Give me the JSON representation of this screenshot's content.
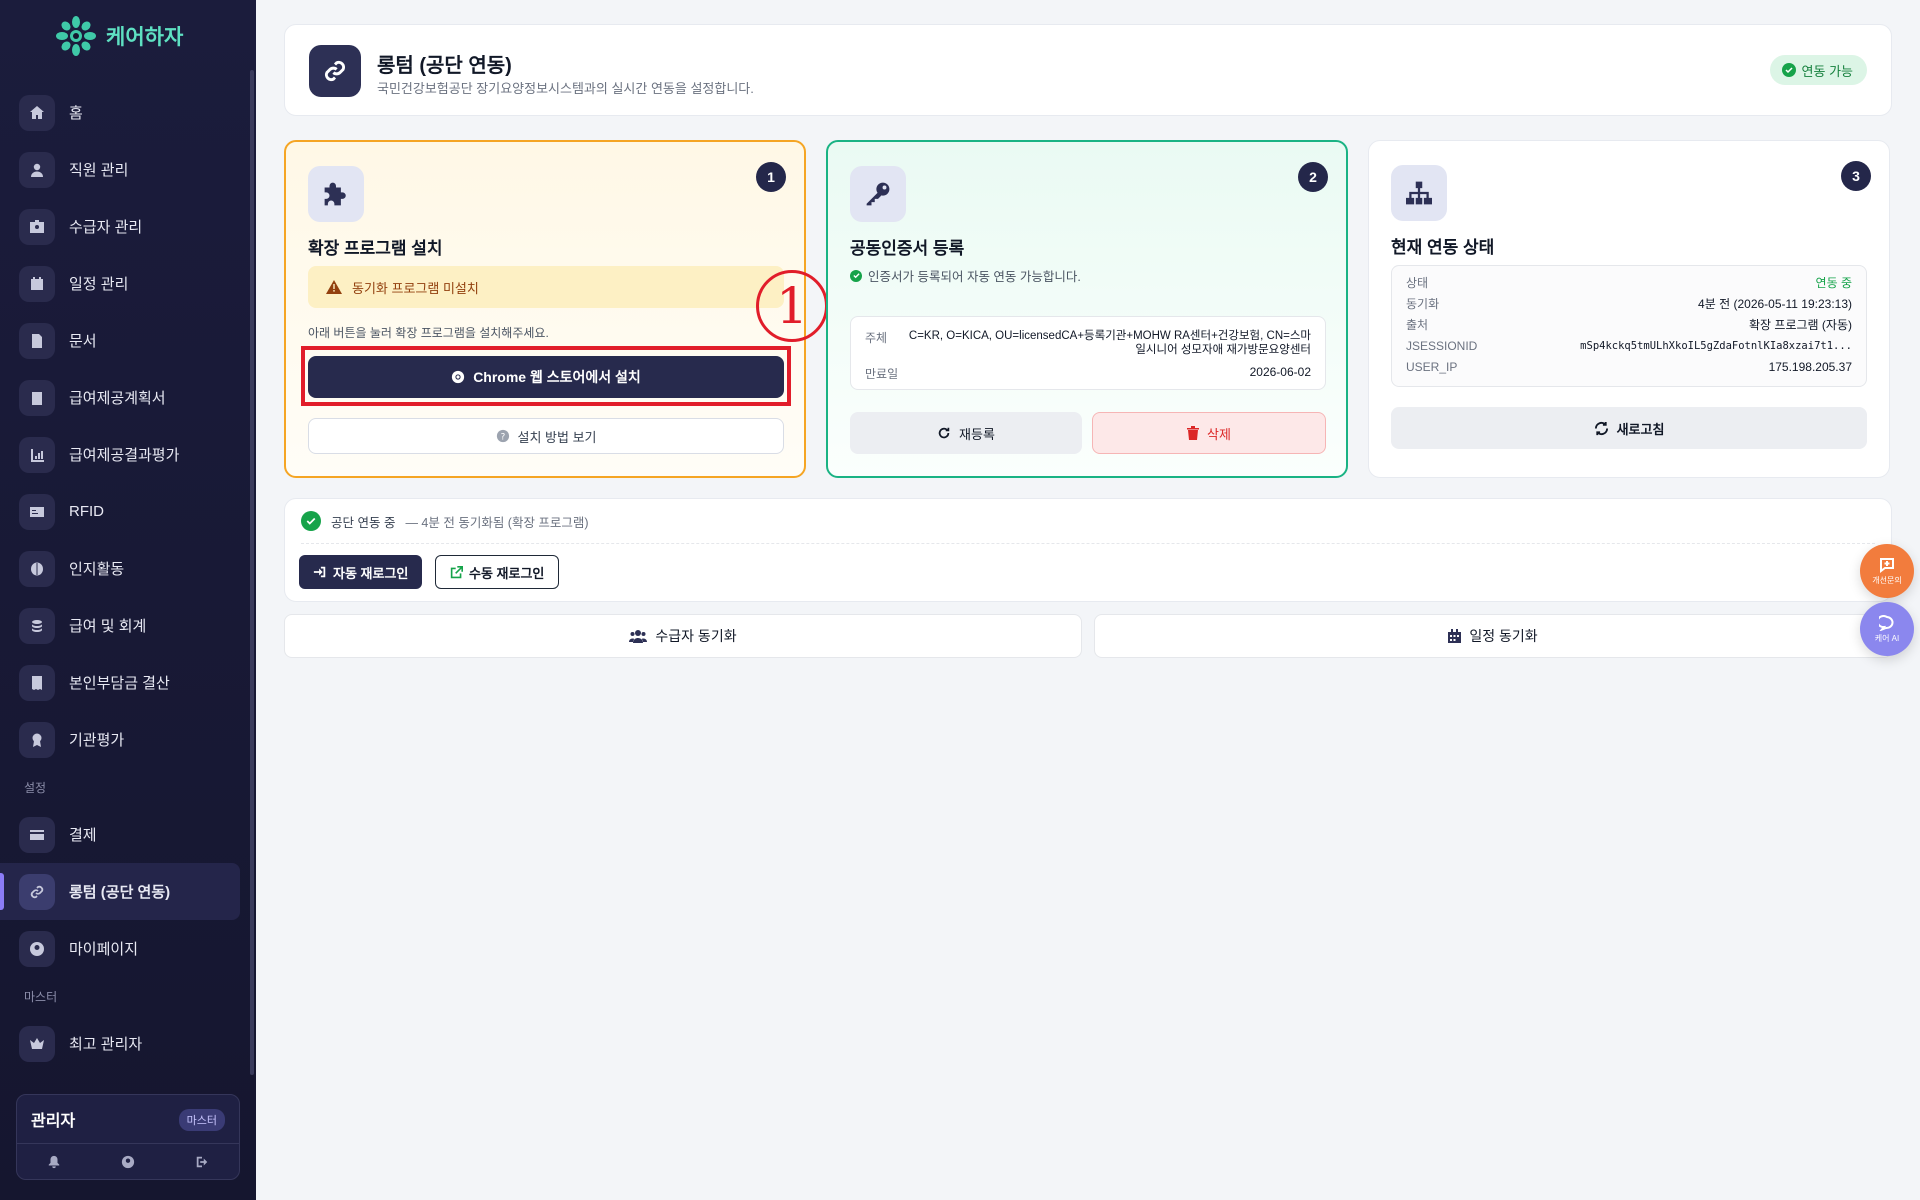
{
  "brand": {
    "name": "케어하자",
    "accent": "#5ee0c2"
  },
  "sidebar": {
    "items": [
      {
        "label": "홈",
        "icon": "home-icon"
      },
      {
        "label": "직원 관리",
        "icon": "user-icon"
      },
      {
        "label": "수급자 관리",
        "icon": "id-card-icon"
      },
      {
        "label": "일정 관리",
        "icon": "calendar-icon"
      },
      {
        "label": "문서",
        "icon": "document-icon"
      },
      {
        "label": "급여제공계획서",
        "icon": "clipboard-icon"
      },
      {
        "label": "급여제공결과평가",
        "icon": "chart-icon"
      },
      {
        "label": "RFID",
        "icon": "rfid-card-icon"
      },
      {
        "label": "인지활동",
        "icon": "brain-icon"
      },
      {
        "label": "급여 및 회계",
        "icon": "coins-icon"
      },
      {
        "label": "본인부담금 결산",
        "icon": "receipt-icon"
      },
      {
        "label": "기관평가",
        "icon": "award-icon"
      }
    ],
    "section_settings": "설정",
    "settings_items": [
      {
        "label": "결제",
        "icon": "credit-card-icon"
      },
      {
        "label": "롱텀 (공단 연동)",
        "icon": "link-icon",
        "active": true
      },
      {
        "label": "마이페이지",
        "icon": "user-circle-icon"
      }
    ],
    "section_master": "마스터",
    "master_items": [
      {
        "label": "최고 관리자",
        "icon": "crown-icon"
      }
    ],
    "user": {
      "name": "관리자",
      "badge": "마스터"
    }
  },
  "header": {
    "title": "롱텀 (공단 연동)",
    "subtitle": "국민건강보험공단 장기요양정보시스템과의 실시간 연동을 설정합니다.",
    "status_pill": "연동 가능"
  },
  "step1": {
    "number": "1",
    "title": "확장 프로그램 설치",
    "warning": "동기화 프로그램 미설치",
    "hint": "아래 버튼을 눌러 확장 프로그램을 설치해주세요.",
    "install_button": "Chrome 웹 스토어에서 설치",
    "guide_button": "설치 방법 보기"
  },
  "annotation": {
    "number": "1"
  },
  "step2": {
    "number": "2",
    "title": "공동인증서 등록",
    "ok_text": "인증서가 등록되어 자동 연동 가능합니다.",
    "subject_label": "주체",
    "subject_value": "C=KR, O=KICA, OU=licensedCA+등록기관+MOHW RA센터+건강보험, CN=스마일시니어 성모자애 재가방문요양센터",
    "expiry_label": "만료일",
    "expiry_value": "2026-06-02",
    "reregister_button": "재등록",
    "delete_button": "삭제"
  },
  "step3": {
    "number": "3",
    "title": "현재 연동 상태",
    "rows": [
      {
        "key": "상태",
        "value": "연동 중"
      },
      {
        "key": "동기화",
        "value": "4분 전 (2026-05-11 19:23:13)"
      },
      {
        "key": "출처",
        "value": "확장 프로그램 (자동)"
      },
      {
        "key": "JSESSIONID",
        "value": "mSp4kckq5tmULhXkoIL5gZdaFotnlKIa8xzai7t1..."
      },
      {
        "key": "USER_IP",
        "value": "175.198.205.37"
      }
    ],
    "refresh_button": "새로고침"
  },
  "status_bar": {
    "status": "공단 연동 중",
    "detail": "— 4분 전 동기화됨 (확장 프로그램)",
    "auto_login_button": "자동 재로그인",
    "manual_login_button": "수동 재로그인"
  },
  "sync": {
    "recipients_button": "수급자 동기화",
    "schedule_button": "일정 동기화"
  },
  "fabs": {
    "feedback_label": "개선문의",
    "ai_label": "케어 AI"
  }
}
